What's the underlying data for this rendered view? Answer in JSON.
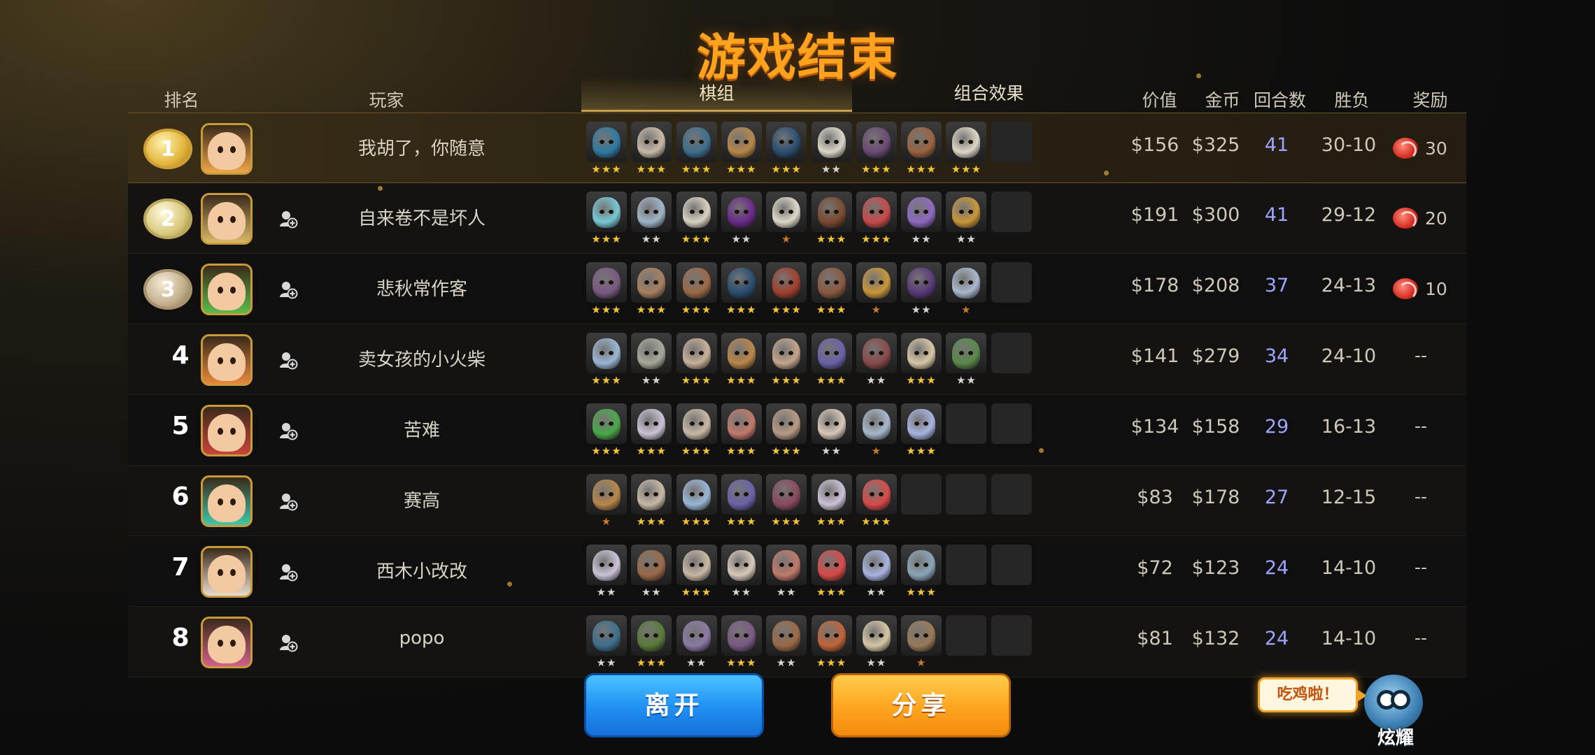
{
  "title": "游戏结束",
  "headers": {
    "rank": "排名",
    "player": "玩家",
    "lineup_tab": "棋组",
    "synergy_tab": "组合效果",
    "value": "价值",
    "gold": "金币",
    "rounds": "回合数",
    "record": "胜负",
    "reward": "奖励"
  },
  "star_colors": {
    "gold": "#f4c534",
    "silver": "#d6d6d6",
    "bronze": "#c97a2a"
  },
  "rows": [
    {
      "rank": "1",
      "medal": "gold",
      "name": "我胡了，你随意",
      "value": "$156",
      "gold": "$325",
      "rounds": "41",
      "record": "30-10",
      "reward": "30",
      "has_add": false,
      "avatar": "#f0a64a",
      "units": [
        {
          "c": "#2e7aa0",
          "s": 3
        },
        {
          "c": "#c8b8a6",
          "s": 3
        },
        {
          "c": "#3e6f8c",
          "s": 3
        },
        {
          "c": "#b8864a",
          "s": 3
        },
        {
          "c": "#2a4e70",
          "s": 3
        },
        {
          "c": "#d9d5c7",
          "s": 2
        },
        {
          "c": "#6b4a74",
          "s": 3
        },
        {
          "c": "#9a6240",
          "s": 3
        },
        {
          "c": "#ddd6c6",
          "s": 3
        }
      ]
    },
    {
      "rank": "2",
      "medal": "silver",
      "name": "自来卷不是坏人",
      "value": "$191",
      "gold": "$300",
      "rounds": "41",
      "record": "29-12",
      "reward": "20",
      "has_add": true,
      "avatar": "#d9b96a",
      "units": [
        {
          "c": "#77c8d4",
          "s": 3
        },
        {
          "c": "#9fb5c8",
          "s": 2
        },
        {
          "c": "#d8d2c0",
          "s": 3
        },
        {
          "c": "#6a2a8a",
          "s": 2
        },
        {
          "c": "#ddd8c8",
          "s": 1
        },
        {
          "c": "#7a4a30",
          "s": 3
        },
        {
          "c": "#c84a4a",
          "s": 3
        },
        {
          "c": "#8e6ac0",
          "s": 2
        },
        {
          "c": "#c8963a",
          "s": 2
        }
      ]
    },
    {
      "rank": "3",
      "medal": "bronze",
      "name": "悲秋常作客",
      "value": "$178",
      "gold": "$208",
      "rounds": "37",
      "record": "24-13",
      "reward": "10",
      "has_add": true,
      "avatar": "#5abc4a",
      "units": [
        {
          "c": "#7a5a84",
          "s": 3
        },
        {
          "c": "#a88060",
          "s": 3
        },
        {
          "c": "#9a6a48",
          "s": 3
        },
        {
          "c": "#2a4e70",
          "s": 3
        },
        {
          "c": "#a0402e",
          "s": 3
        },
        {
          "c": "#8a5a40",
          "s": 3
        },
        {
          "c": "#c8963a",
          "s": 1
        },
        {
          "c": "#5a3a7a",
          "s": 2
        },
        {
          "c": "#a8b8cc",
          "s": 1
        }
      ]
    },
    {
      "rank": "4",
      "medal": "",
      "name": "卖女孩的小火柴",
      "value": "$141",
      "gold": "$279",
      "rounds": "34",
      "record": "24-10",
      "reward": "--",
      "has_add": true,
      "avatar": "#e8883a",
      "units": [
        {
          "c": "#9ab6d4",
          "s": 3
        },
        {
          "c": "#a8a89a",
          "s": 2
        },
        {
          "c": "#c8b09a",
          "s": 3
        },
        {
          "c": "#b8864a",
          "s": 3
        },
        {
          "c": "#c4a48c",
          "s": 3
        },
        {
          "c": "#6a62a8",
          "s": 3
        },
        {
          "c": "#8a4a4a",
          "s": 2
        },
        {
          "c": "#d6c6a6",
          "s": 3
        },
        {
          "c": "#5a8a4a",
          "s": 2
        }
      ]
    },
    {
      "rank": "5",
      "medal": "",
      "name": "苦难",
      "value": "$134",
      "gold": "$158",
      "rounds": "29",
      "record": "16-13",
      "reward": "--",
      "has_add": true,
      "avatar": "#c8443a",
      "units": [
        {
          "c": "#4aa84a",
          "s": 3
        },
        {
          "c": "#cac2d6",
          "s": 3
        },
        {
          "c": "#c8b8a6",
          "s": 3
        },
        {
          "c": "#c07a6a",
          "s": 3
        },
        {
          "c": "#b89a84",
          "s": 3
        },
        {
          "c": "#d8c8b8",
          "s": 2
        },
        {
          "c": "#a8b8cc",
          "s": 1
        },
        {
          "c": "#a8b4e0",
          "s": 3
        },
        {
          "c": "",
          "s": 0
        },
        {
          "c": "",
          "s": 0
        }
      ]
    },
    {
      "rank": "6",
      "medal": "",
      "name": "赛高",
      "value": "$83",
      "gold": "$178",
      "rounds": "27",
      "record": "12-15",
      "reward": "--",
      "has_add": true,
      "avatar": "#3ec8a8",
      "units": [
        {
          "c": "#b8864a",
          "s": 1
        },
        {
          "c": "#c8b8a6",
          "s": 3
        },
        {
          "c": "#9ab6d4",
          "s": 3
        },
        {
          "c": "#6a62a8",
          "s": 3
        },
        {
          "c": "#8a4a60",
          "s": 3
        },
        {
          "c": "#cac2d6",
          "s": 3
        },
        {
          "c": "#d84a4a",
          "s": 3
        },
        {
          "c": "",
          "s": 0
        },
        {
          "c": "",
          "s": 0
        },
        {
          "c": "",
          "s": 0
        }
      ]
    },
    {
      "rank": "7",
      "medal": "",
      "name": "西木小改改",
      "value": "$72",
      "gold": "$123",
      "rounds": "24",
      "record": "14-10",
      "reward": "--",
      "has_add": true,
      "avatar": "#e9ddd0",
      "units": [
        {
          "c": "#cac2d6",
          "s": 2
        },
        {
          "c": "#9a6a48",
          "s": 2
        },
        {
          "c": "#c8b8a6",
          "s": 3
        },
        {
          "c": "#d8c8b8",
          "s": 2
        },
        {
          "c": "#c07a6a",
          "s": 2
        },
        {
          "c": "#d84a4a",
          "s": 3
        },
        {
          "c": "#a8b4e0",
          "s": 2
        },
        {
          "c": "#8aa6b8",
          "s": 3
        },
        {
          "c": "",
          "s": 0
        },
        {
          "c": "",
          "s": 0
        }
      ]
    },
    {
      "rank": "8",
      "medal": "",
      "name": "popo",
      "value": "$81",
      "gold": "$132",
      "rounds": "24",
      "record": "14-10",
      "reward": "--",
      "has_add": true,
      "avatar": "#d0608a",
      "units": [
        {
          "c": "#3e6f8c",
          "s": 2
        },
        {
          "c": "#5a7a3a",
          "s": 3
        },
        {
          "c": "#8a7aa4",
          "s": 2
        },
        {
          "c": "#7a5a84",
          "s": 3
        },
        {
          "c": "#9a6a48",
          "s": 2
        },
        {
          "c": "#c0643a",
          "s": 3
        },
        {
          "c": "#d6c6a6",
          "s": 2
        },
        {
          "c": "#9a7a5a",
          "s": 1
        },
        {
          "c": "",
          "s": 0
        },
        {
          "c": "",
          "s": 0
        }
      ]
    }
  ],
  "buttons": {
    "leave": "离开",
    "share": "分享"
  },
  "bubble": "吃鸡啦！",
  "show_off": "炫耀"
}
